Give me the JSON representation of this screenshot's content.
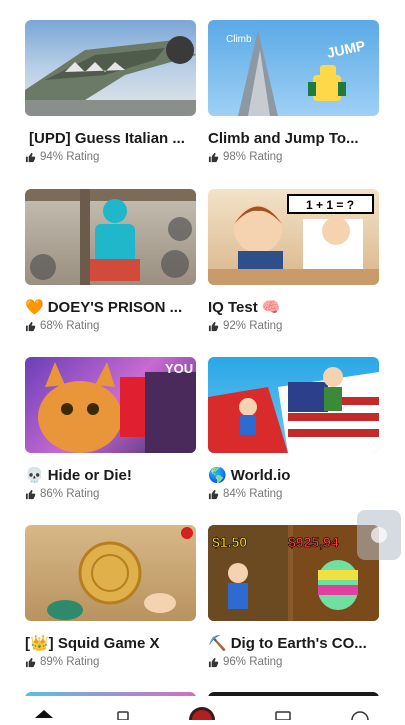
{
  "games": [
    {
      "title": "[UPD] Guess Italian ...",
      "emoji": "",
      "rating": "94% Rating",
      "thumb": "crocodile-plane"
    },
    {
      "title": "Climb and Jump To...",
      "emoji": "",
      "rating": "98% Rating",
      "thumb": "tower-jump"
    },
    {
      "title": "DOEY'S PRISON ...",
      "emoji": "🧡",
      "rating": "68% Rating",
      "thumb": "prison"
    },
    {
      "title": "IQ Test",
      "emoji": "🧠",
      "rating": "92% Rating",
      "thumb": "iq-test"
    },
    {
      "title": "Hide or Die!",
      "emoji": "💀",
      "rating": "86% Rating",
      "thumb": "cat-you"
    },
    {
      "title": "World.io",
      "emoji": "🌎",
      "rating": "84% Rating",
      "thumb": "world-map"
    },
    {
      "title": "[👑] Squid Game X",
      "emoji": "",
      "rating": "89% Rating",
      "thumb": "cookie"
    },
    {
      "title": "Dig to Earth's CO...",
      "emoji": "⛏️",
      "rating": "96% Rating",
      "thumb": "dig"
    }
  ],
  "thumb_text": {
    "jump": "JUMP",
    "climb": "Climb",
    "iq_equation": "1 + 1 = ?",
    "you": "YOU",
    "price_left": "$1.50",
    "price_right": "$925,94"
  },
  "colors": {
    "title": "#1b1b1b",
    "rating": "#777777"
  }
}
